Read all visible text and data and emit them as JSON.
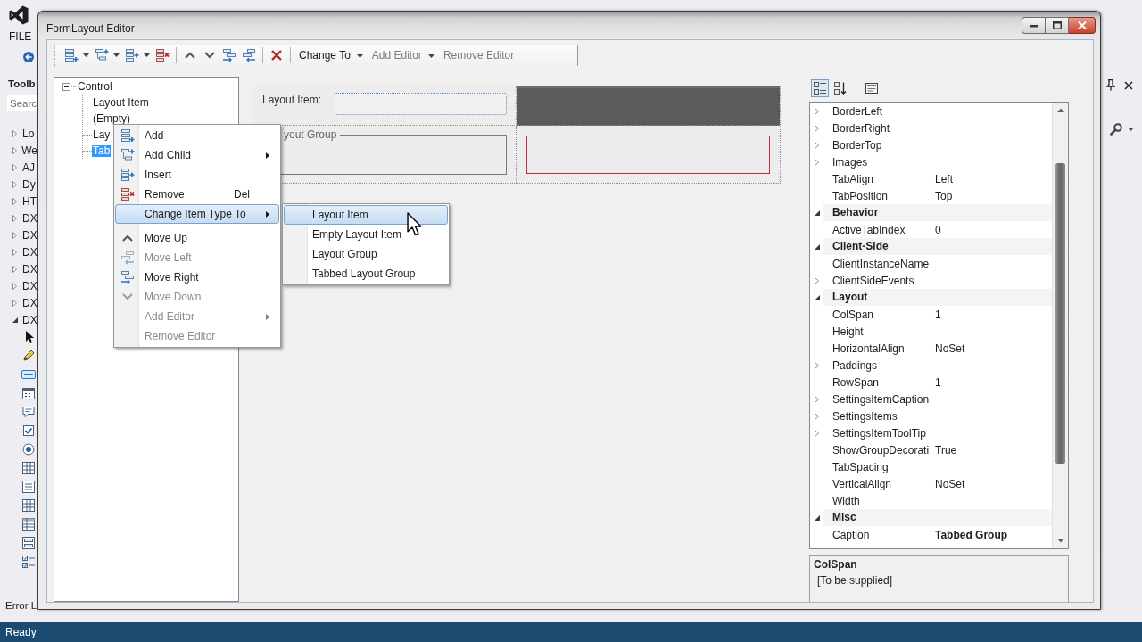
{
  "ide": {
    "menu": [
      {
        "label": "FILE"
      }
    ],
    "toolbox": {
      "title": "Toolb",
      "search": {
        "placeholder": "Searc"
      },
      "groups": [
        {
          "label": "Lo",
          "expanded": false
        },
        {
          "label": "We",
          "expanded": false
        },
        {
          "label": "AJ",
          "expanded": false
        },
        {
          "label": "Dy",
          "expanded": false
        },
        {
          "label": "HT",
          "expanded": false
        },
        {
          "label": "DX",
          "expanded": false
        },
        {
          "label": "DX",
          "expanded": false
        },
        {
          "label": "DX",
          "expanded": false
        },
        {
          "label": "DX",
          "expanded": false
        },
        {
          "label": "DX",
          "expanded": false
        },
        {
          "label": "DX",
          "expanded": false
        },
        {
          "label": "DX",
          "expanded": true
        }
      ]
    },
    "bottom_tab": "Error L",
    "status_bar": "Ready"
  },
  "dialog": {
    "title": "FormLayout Editor",
    "toolbar": {
      "menus": [
        {
          "label": "Change To",
          "dropdown": true,
          "disabled": false
        },
        {
          "label": "Add Editor",
          "dropdown": true,
          "disabled": true
        },
        {
          "label": "Remove Editor",
          "dropdown": false,
          "disabled": true
        }
      ]
    },
    "tree": {
      "label": "Control",
      "expanded": true,
      "selected": false,
      "children": [
        {
          "label": "Layout Item",
          "selected": false
        },
        {
          "label": "(Empty)",
          "selected": false
        },
        {
          "label": "Lay",
          "selected": false
        },
        {
          "label": "Tab",
          "selected": true
        }
      ]
    },
    "preview": {
      "item_label": "Layout Item:",
      "group_caption": "yout Group"
    },
    "context_menu": {
      "items": [
        {
          "kind": "item",
          "label": "Add",
          "submenu": false,
          "disabled": false,
          "selected": false
        },
        {
          "kind": "item",
          "label": "Add Child",
          "submenu": true,
          "disabled": false,
          "selected": false
        },
        {
          "kind": "item",
          "label": "Insert",
          "submenu": false,
          "disabled": false,
          "selected": false
        },
        {
          "kind": "item",
          "label": "Remove",
          "shortcut": "Del",
          "submenu": false,
          "disabled": false,
          "selected": false
        },
        {
          "kind": "item",
          "label": "Change Item Type To",
          "submenu": true,
          "disabled": false,
          "selected": true
        },
        {
          "kind": "separator"
        },
        {
          "kind": "item",
          "label": "Move Up",
          "submenu": false,
          "disabled": false,
          "selected": false
        },
        {
          "kind": "item",
          "label": "Move Left",
          "submenu": false,
          "disabled": true,
          "selected": false
        },
        {
          "kind": "item",
          "label": "Move Right",
          "submenu": false,
          "disabled": false,
          "selected": false
        },
        {
          "kind": "item",
          "label": "Move Down",
          "submenu": false,
          "disabled": true,
          "selected": false
        },
        {
          "kind": "item",
          "label": "Add Editor",
          "submenu": true,
          "disabled": true,
          "selected": false
        },
        {
          "kind": "item",
          "label": "Remove Editor",
          "submenu": false,
          "disabled": true,
          "selected": false
        }
      ]
    },
    "submenu": {
      "items": [
        {
          "label": "Layout Item",
          "selected": true
        },
        {
          "label": "Empty Layout Item",
          "selected": false
        },
        {
          "label": "Layout Group",
          "selected": false
        },
        {
          "label": "Tabbed Layout Group",
          "selected": false
        }
      ]
    },
    "properties": {
      "sort_buttons": [
        {
          "selected": true
        },
        {
          "selected": false
        }
      ],
      "rows": [
        {
          "kind": "property",
          "name": "BorderLeft",
          "expandable": true
        },
        {
          "kind": "property",
          "name": "BorderRight",
          "expandable": true
        },
        {
          "kind": "property",
          "name": "BorderTop",
          "expandable": true
        },
        {
          "kind": "property",
          "name": "Images",
          "expandable": true
        },
        {
          "kind": "property",
          "name": "TabAlign",
          "value": "Left",
          "expandable": false,
          "modified": false
        },
        {
          "kind": "property",
          "name": "TabPosition",
          "value": "Top",
          "expandable": false,
          "modified": false
        },
        {
          "kind": "category",
          "name": "Behavior",
          "expanded": true
        },
        {
          "kind": "property",
          "name": "ActiveTabIndex",
          "value": "0",
          "expandable": false,
          "modified": false
        },
        {
          "kind": "category",
          "name": "Client-Side",
          "expanded": true
        },
        {
          "kind": "property",
          "name": "ClientInstanceName",
          "expandable": false
        },
        {
          "kind": "property",
          "name": "ClientSideEvents",
          "expandable": true
        },
        {
          "kind": "category",
          "name": "Layout",
          "expanded": true
        },
        {
          "kind": "property",
          "name": "ColSpan",
          "value": "1",
          "expandable": false,
          "modified": false
        },
        {
          "kind": "property",
          "name": "Height",
          "expandable": false
        },
        {
          "kind": "property",
          "name": "HorizontalAlign",
          "value": "NoSet",
          "expandable": false,
          "modified": false
        },
        {
          "kind": "property",
          "name": "Paddings",
          "expandable": true
        },
        {
          "kind": "property",
          "name": "RowSpan",
          "value": "1",
          "expandable": false,
          "modified": false
        },
        {
          "kind": "property",
          "name": "SettingsItemCaption",
          "expandable": true
        },
        {
          "kind": "property",
          "name": "SettingsItems",
          "expandable": true
        },
        {
          "kind": "property",
          "name": "SettingsItemToolTip",
          "expandable": true
        },
        {
          "kind": "property",
          "name": "ShowGroupDecorati",
          "value": "True",
          "expandable": false,
          "modified": false
        },
        {
          "kind": "property",
          "name": "TabSpacing",
          "expandable": false
        },
        {
          "kind": "property",
          "name": "VerticalAlign",
          "value": "NoSet",
          "expandable": false,
          "modified": false
        },
        {
          "kind": "property",
          "name": "Width",
          "expandable": false
        },
        {
          "kind": "category",
          "name": "Misc",
          "expanded": true
        },
        {
          "kind": "property",
          "name": "Caption",
          "value": "Tabbed Group",
          "expandable": false,
          "modified": true
        }
      ],
      "description": {
        "title": "ColSpan",
        "text": "[To be supplied]"
      }
    }
  }
}
